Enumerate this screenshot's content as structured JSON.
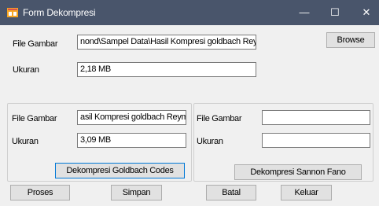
{
  "window": {
    "title": "Form Dekompresi",
    "minimize_glyph": "—",
    "maximize_glyph": "☐",
    "close_glyph": "✕",
    "icon": "app-form-icon",
    "title_bar_color": "#49556b"
  },
  "top": {
    "file_label": "File Gambar",
    "file_value": "nond\\Sampel Data\\Hasil Kompresi goldbach Reymond",
    "browse_label": "Browse",
    "size_label": "Ukuran",
    "size_value": "2,18 MB"
  },
  "left_group": {
    "file_label": "File Gambar",
    "file_value": "asil Kompresi goldbach Reymond",
    "size_label": "Ukuran",
    "size_value": "3,09 MB",
    "button_label": "Dekompresi Goldbach Codes"
  },
  "right_group": {
    "file_label": "File Gambar",
    "file_value": "",
    "size_label": "Ukuran",
    "size_value": "",
    "button_label": "Dekompresi Sannon Fano"
  },
  "bottom": {
    "proses_label": "Proses",
    "simpan_label": "Simpan",
    "batal_label": "Batal",
    "keluar_label": "Keluar"
  }
}
